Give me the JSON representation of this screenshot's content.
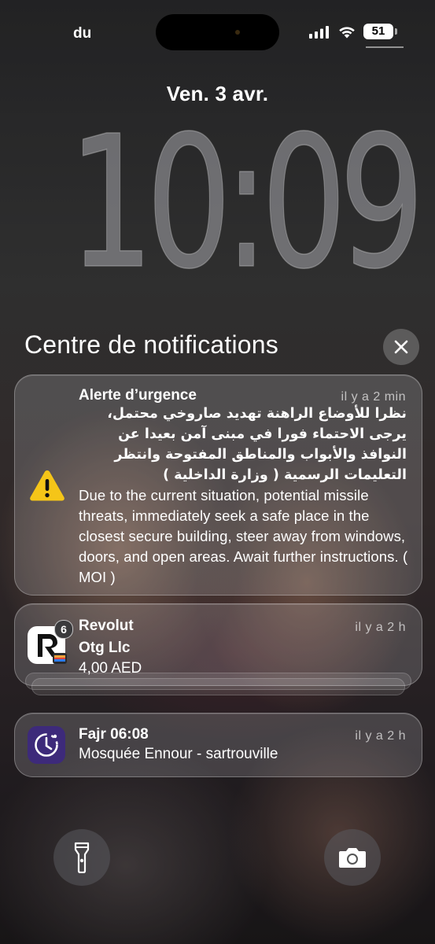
{
  "status_bar": {
    "carrier": "du",
    "battery": "51"
  },
  "lock_screen": {
    "date": "Ven. 3 avr.",
    "time": "10:09"
  },
  "notification_center": {
    "title": "Centre de notifications",
    "notifications": [
      {
        "app": "Alerte d’urgence",
        "time": "il y a 2 min",
        "icon": "warning-icon",
        "arabic_text": "نظرا للأوضاع الراهنة تهديد صاروخي محتمل، يرجى الاحتماء فورا في مبنى آمن بعيدا عن النوافذ والأبواب والمناطق المفتوحة وانتظر التعليمات الرسمية ( وزارة الداخلية )",
        "english_text": "Due to the current situation, potential missile threats,  immediately seek a safe place in the closest secure building, steer away from windows, doors, and open areas. Await further instructions. ( MOI  )"
      },
      {
        "app": "Revolut",
        "time": "il y a 2 h",
        "icon": "revolut-icon",
        "badge": "6",
        "subtitle": "Otg Llc",
        "body": "4,00 AED"
      },
      {
        "app": "Fajr 06:08",
        "time": "il y a 2 h",
        "icon": "prayer-clock-icon",
        "body": "Mosquée Ennour - sartrouville"
      }
    ]
  },
  "quick_actions": {
    "flashlight": "flashlight-icon",
    "camera": "camera-icon"
  },
  "colors": {
    "warning": "#f5c518",
    "fajr_icon": "#3d2a7a"
  }
}
